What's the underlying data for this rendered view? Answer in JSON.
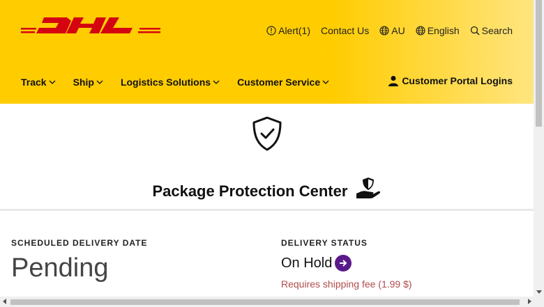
{
  "header": {
    "logo_text": "DHL",
    "utility": {
      "alert": "Alert(1)",
      "contact": "Contact Us",
      "region": "AU",
      "language": "English",
      "search": "Search"
    },
    "nav": [
      "Track",
      "Ship",
      "Logistics Solutions",
      "Customer Service"
    ],
    "portal": "Customer Portal Logins"
  },
  "protection": {
    "title": "Package Protection Center"
  },
  "delivery": {
    "date_label": "SCHEDULED DELIVERY DATE",
    "date_value": "Pending",
    "status_label": "DELIVERY STATUS",
    "status_value": "On Hold",
    "fee_note": "Requires shipping fee (1.99 $)"
  },
  "colors": {
    "brand_yellow": "#ffcc00",
    "brand_red": "#d40511",
    "action_purple": "#5a1a8c",
    "fee_red": "#b04b4b"
  }
}
